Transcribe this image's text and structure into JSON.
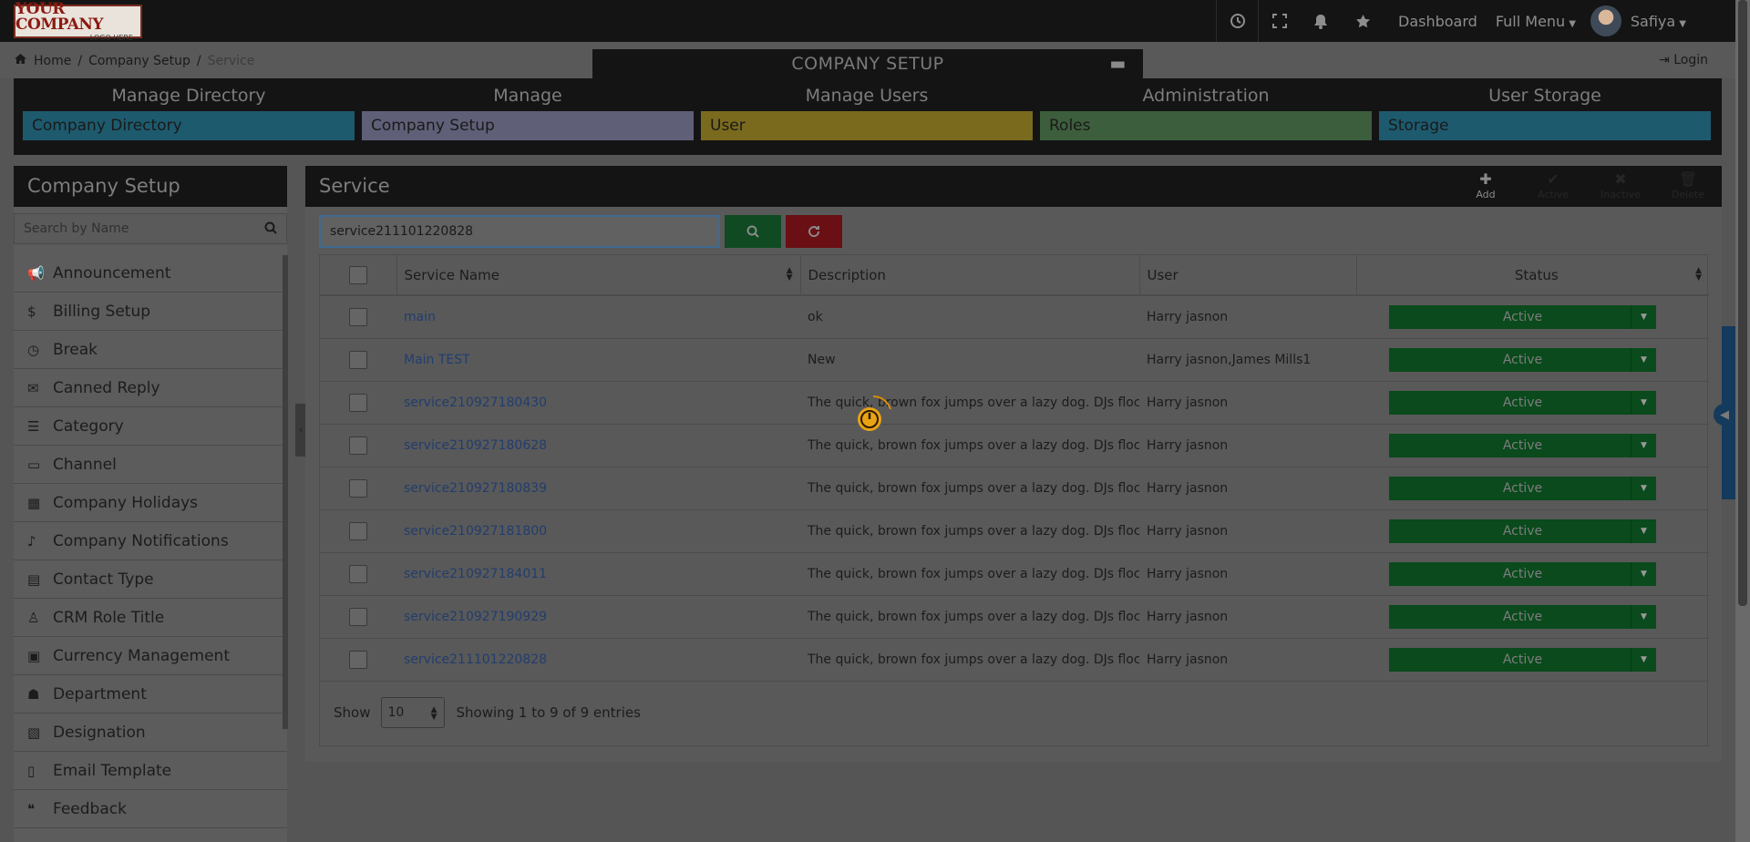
{
  "logo": {
    "line1": "YOUR COMPANY",
    "line2": "LOGO HERE"
  },
  "topnav": {
    "dashboard": "Dashboard",
    "full_menu": "Full Menu",
    "user": "Safiya"
  },
  "breadcrumb": {
    "home": "Home",
    "company_setup": "Company Setup",
    "current": "Service"
  },
  "login": "Login",
  "company_setup_tab": "COMPANY SETUP",
  "mega_menu": [
    {
      "heading": "Manage Directory",
      "item": "Company Directory",
      "color": "#1d5a6e"
    },
    {
      "heading": "Manage",
      "item": "Company Setup",
      "color": "#5f5f78"
    },
    {
      "heading": "Manage Users",
      "item": "User",
      "color": "#7a6a1e"
    },
    {
      "heading": "Administration",
      "item": "Roles",
      "color": "#3d5e3d"
    },
    {
      "heading": "User Storage",
      "item": "Storage",
      "color": "#1d5a6e"
    }
  ],
  "sidebar": {
    "title": "Company Setup",
    "search_placeholder": "Search by Name",
    "items": [
      {
        "label": "Announcement",
        "icon": "bullhorn-icon"
      },
      {
        "label": "Billing Setup",
        "icon": "dollar-icon"
      },
      {
        "label": "Break",
        "icon": "clock-icon"
      },
      {
        "label": "Canned Reply",
        "icon": "envelope-icon"
      },
      {
        "label": "Category",
        "icon": "list-icon"
      },
      {
        "label": "Channel",
        "icon": "desktop-icon"
      },
      {
        "label": "Company Holidays",
        "icon": "calendar-icon"
      },
      {
        "label": "Company Notifications",
        "icon": "bell-icon"
      },
      {
        "label": "Contact Type",
        "icon": "card-icon"
      },
      {
        "label": "CRM Role Title",
        "icon": "user-icon"
      },
      {
        "label": "Currency Management",
        "icon": "money-icon"
      },
      {
        "label": "Department",
        "icon": "users-icon"
      },
      {
        "label": "Designation",
        "icon": "id-card-icon"
      },
      {
        "label": "Email Template",
        "icon": "file-icon"
      },
      {
        "label": "Feedback",
        "icon": "quote-icon"
      }
    ]
  },
  "panel": {
    "title": "Service",
    "tools": {
      "add": "Add",
      "active": "Active",
      "inactive": "Inactive",
      "delete": "Delete"
    },
    "search_value": "service211101220828"
  },
  "table": {
    "columns": {
      "name": "Service Name",
      "description": "Description",
      "user": "User",
      "status": "Status"
    },
    "rows": [
      {
        "name": "main",
        "description": "ok",
        "user": "Harry jasnon",
        "status": "Active"
      },
      {
        "name": "Main TEST",
        "description": "New",
        "user": "Harry jasnon,James Mills1",
        "status": "Active"
      },
      {
        "name": "service210927180430",
        "description": "The quick, brown fox jumps over a lazy dog. DJs flock",
        "user": "Harry jasnon",
        "status": "Active"
      },
      {
        "name": "service210927180628",
        "description": "The quick, brown fox jumps over a lazy dog. DJs flock",
        "user": "Harry jasnon",
        "status": "Active"
      },
      {
        "name": "service210927180839",
        "description": "The quick, brown fox jumps over a lazy dog. DJs flock",
        "user": "Harry jasnon",
        "status": "Active"
      },
      {
        "name": "service210927181800",
        "description": "The quick, brown fox jumps over a lazy dog. DJs flock",
        "user": "Harry jasnon",
        "status": "Active"
      },
      {
        "name": "service210927184011",
        "description": "The quick, brown fox jumps over a lazy dog. DJs flock",
        "user": "Harry jasnon",
        "status": "Active"
      },
      {
        "name": "service210927190929",
        "description": "The quick, brown fox jumps over a lazy dog. DJs flock",
        "user": "Harry jasnon",
        "status": "Active"
      },
      {
        "name": "service211101220828",
        "description": "The quick, brown fox jumps over a lazy dog. DJs flock",
        "user": "Harry jasnon",
        "status": "Active"
      }
    ]
  },
  "footer": {
    "show_label": "Show",
    "page_size": "10",
    "info": "Showing 1 to 9 of 9 entries"
  }
}
